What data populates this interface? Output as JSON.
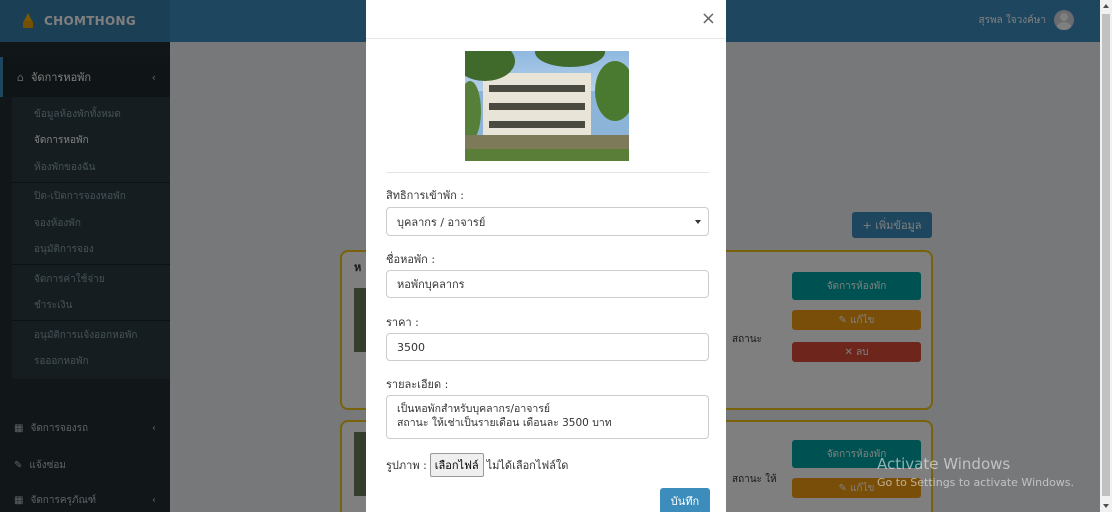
{
  "app": {
    "logo_text": "CHOMTHONG"
  },
  "header": {
    "user_name": "สุรพล ใจวงค์ษา"
  },
  "sidebar": {
    "main_menu": {
      "icon": "home-icon",
      "label": "จัดการหอพัก"
    },
    "submenu": [
      "ข้อมูลห้องพักทั้งหมด",
      "จัดการหอพัก",
      "ห้องพักของฉัน",
      "ปิด-เปิดการจองหอพัก",
      "จองห้องพัก",
      "อนุมัติการจอง",
      "จัดการค่าใช้จ่าย",
      "ชำระเงิน",
      "อนุมัติการแจ้งออกหอพัก",
      "รอออกหอพัก"
    ],
    "other_menu": [
      {
        "icon": "grid-icon",
        "label": "จัดการจองรถ"
      },
      {
        "icon": "wrench-icon",
        "label": "แจ้งซ่อม"
      },
      {
        "icon": "grid-icon",
        "label": "จัดการครุภัณฑ์"
      }
    ]
  },
  "content": {
    "add_button": "+ เพิ่มข้อมูล",
    "card1": {
      "title": "ห",
      "desc": "สถานะ",
      "manage_btn": "จัดการห้องพัก",
      "edit_btn": "แก้ไข",
      "delete_btn": "ลบ"
    },
    "card2": {
      "desc": "สถานะ ให้",
      "manage_btn": "จัดการห้องพัก",
      "edit_btn": "แก้ไข"
    }
  },
  "modal": {
    "close": "×",
    "fields": {
      "rights_label": "สิทธิการเข้าพัก :",
      "rights_value": "บุคลากร / อาจารย์",
      "name_label": "ชื่อหอพัก :",
      "name_value": "หอพักบุคลากร",
      "price_label": "ราคา :",
      "price_value": "3500",
      "detail_label": "รายละเอียด :",
      "detail_value": "เป็นหอพักสำหรับบุคลากร/อาจารย์\nสถานะ ให้เช่าเป็นรายเดือน เดือนละ 3500 บาท",
      "image_label": "รูปภาพ :",
      "file_button": "เลือกไฟล์",
      "file_status": "ไม่ได้เลือกไฟล์ใด"
    },
    "save": "บันทึก"
  },
  "watermark": {
    "line1": "Activate Windows",
    "line2": "Go to Settings to activate Windows."
  }
}
